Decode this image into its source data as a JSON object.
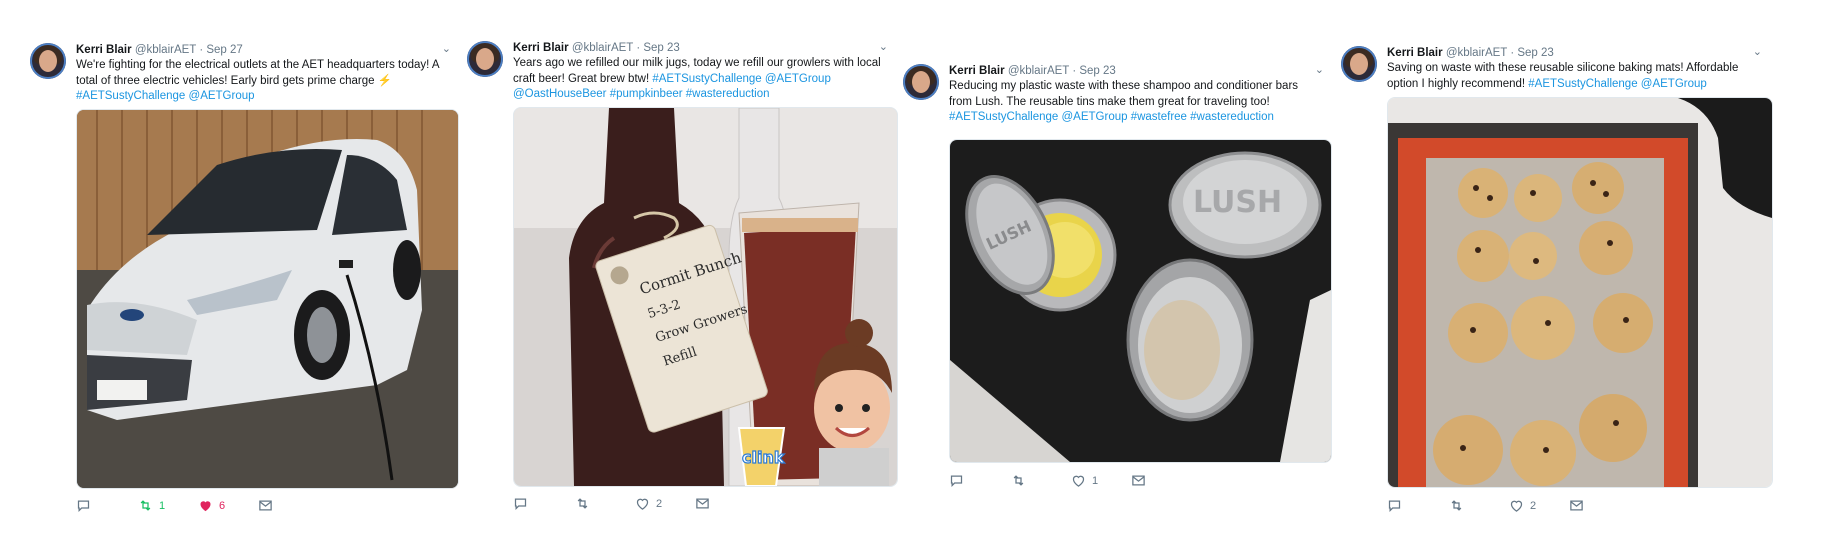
{
  "tweets": [
    {
      "name": "Kerri Blair",
      "handle": "@kblairAET",
      "date": "· Sep 27",
      "text_parts": [
        "We're fighting for the electrical outlets at the AET headquarters today! A total of three electric vehicles! Early bird gets prime charge ⚡ ",
        "#AETSustyChallenge",
        " ",
        "@AETGroup"
      ],
      "image_icon": "electric-car-photo",
      "retweets": "1",
      "likes": "6"
    },
    {
      "name": "Kerri Blair",
      "handle": "@kblairAET",
      "date": "· Sep 23",
      "text_parts": [
        "Years ago we refilled our milk jugs, today we refill our growlers with local craft beer! Great brew btw! ",
        "#AETSustyChallenge @AETGroup @OastHouseBeer #pumpkinbeer #wastereduction"
      ],
      "image_icon": "growler-beer-photo",
      "image_tag_text": "Cormit Bunch 5-3-2 Grow Growers Refill",
      "retweets": "",
      "likes": "2",
      "sticker_text": "clink"
    },
    {
      "name": "Kerri Blair",
      "handle": "@kblairAET",
      "date": "· Sep 23",
      "text_parts": [
        "Reducing my plastic waste with these shampoo and conditioner bars from Lush. The reusable tins make them great for traveling too! ",
        "#AETSustyChallenge @AETGroup #wastefree #wastereduction"
      ],
      "image_icon": "lush-tins-photo",
      "tin_label": "LUSH",
      "retweets": "",
      "likes": "1"
    },
    {
      "name": "Kerri Blair",
      "handle": "@kblairAET",
      "date": "· Sep 23",
      "text_parts": [
        "Saving on waste with these reusable silicone baking mats! Affordable option I highly recommend! ",
        "#AETSustyChallenge @AETGroup"
      ],
      "image_icon": "cookies-baking-mat-photo",
      "retweets": "",
      "likes": "2"
    }
  ],
  "colors": {
    "link": "#1b95e0",
    "retweet": "#17bf63",
    "like": "#e0245e",
    "muted": "#657786"
  }
}
